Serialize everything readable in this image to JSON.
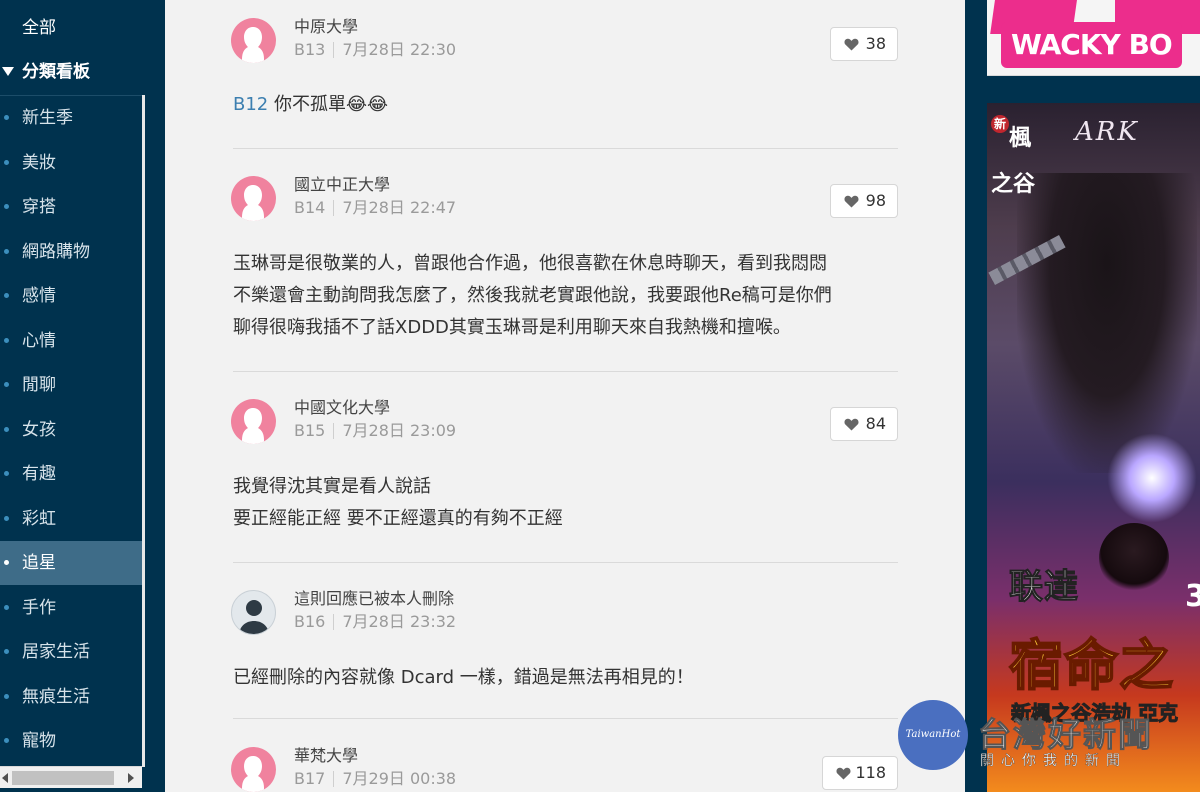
{
  "sidebar": {
    "all_label": "全部",
    "category_label": "分類看板",
    "items": [
      {
        "label": "新生季"
      },
      {
        "label": "美妝"
      },
      {
        "label": "穿搭"
      },
      {
        "label": "網路購物"
      },
      {
        "label": "感情"
      },
      {
        "label": "心情"
      },
      {
        "label": "閒聊"
      },
      {
        "label": "女孩"
      },
      {
        "label": "有趣"
      },
      {
        "label": "彩虹"
      },
      {
        "label": "追星"
      },
      {
        "label": "手作"
      },
      {
        "label": "居家生活"
      },
      {
        "label": "無痕生活"
      },
      {
        "label": "寵物"
      }
    ],
    "active_item": "追星"
  },
  "posts": [
    {
      "school": "中原大學",
      "floor": "B13",
      "time": "7月28日 22:30",
      "likes": "38",
      "reply_ref": "B12",
      "content": [
        " 你不孤單😂😂"
      ],
      "avatar": "female"
    },
    {
      "school": "國立中正大學",
      "floor": "B14",
      "time": "7月28日 22:47",
      "likes": "98",
      "content": [
        "玉琳哥是很敬業的人，曾跟他合作過，他很喜歡在休息時聊天，看到我悶悶",
        "不樂還會主動詢問我怎麼了，然後我就老實跟他說，我要跟他Re稿可是你們",
        "聊得很嗨我插不了話XDDD其實玉琳哥是利用聊天來自我熱機和擅喉。"
      ],
      "avatar": "female"
    },
    {
      "school": "中國文化大學",
      "floor": "B15",
      "time": "7月28日 23:09",
      "likes": "84",
      "content": [
        "我覺得沈其實是看人說話",
        "要正經能正經 要不正經還真的有夠不正經"
      ],
      "avatar": "female"
    },
    {
      "school": "這則回應已被本人刪除",
      "floor": "B16",
      "time": "7月28日 23:32",
      "likes": "",
      "content": [
        "已經刪除的內容就像 Dcard 一樣，錯過是無法再相見的！"
      ],
      "avatar": "male"
    },
    {
      "school": "華梵大學",
      "floor": "B17",
      "time": "7月29日 00:38",
      "likes": "118",
      "content": [],
      "avatar": "female"
    }
  ],
  "ads": {
    "top_banner_text": "WACKY BO",
    "game_logo": "楓之谷",
    "game_logo_badge": "新",
    "game_x_logo": "ARK",
    "game_headline1": "联達",
    "game_headline2": "宿命之",
    "game_number": "3",
    "game_sub": "新楓之谷浩劫 亞克"
  },
  "watermark": {
    "circle_text": "TaiwanHot",
    "title": "台灣好新聞",
    "subtitle": "關心你我的新聞"
  },
  "colors": {
    "sidebar_bg": "#00324e",
    "sidebar_active": "#3e6c88",
    "main_bg": "#f2f2f2",
    "female_avatar": "#f0829e",
    "link_blue": "#3c7fb0",
    "ad_pink": "#ec2d8c"
  },
  "icons": {
    "like": "heart-icon",
    "menu_toggle": "caret-down-icon",
    "avatar": "person-silhouette-icon"
  }
}
